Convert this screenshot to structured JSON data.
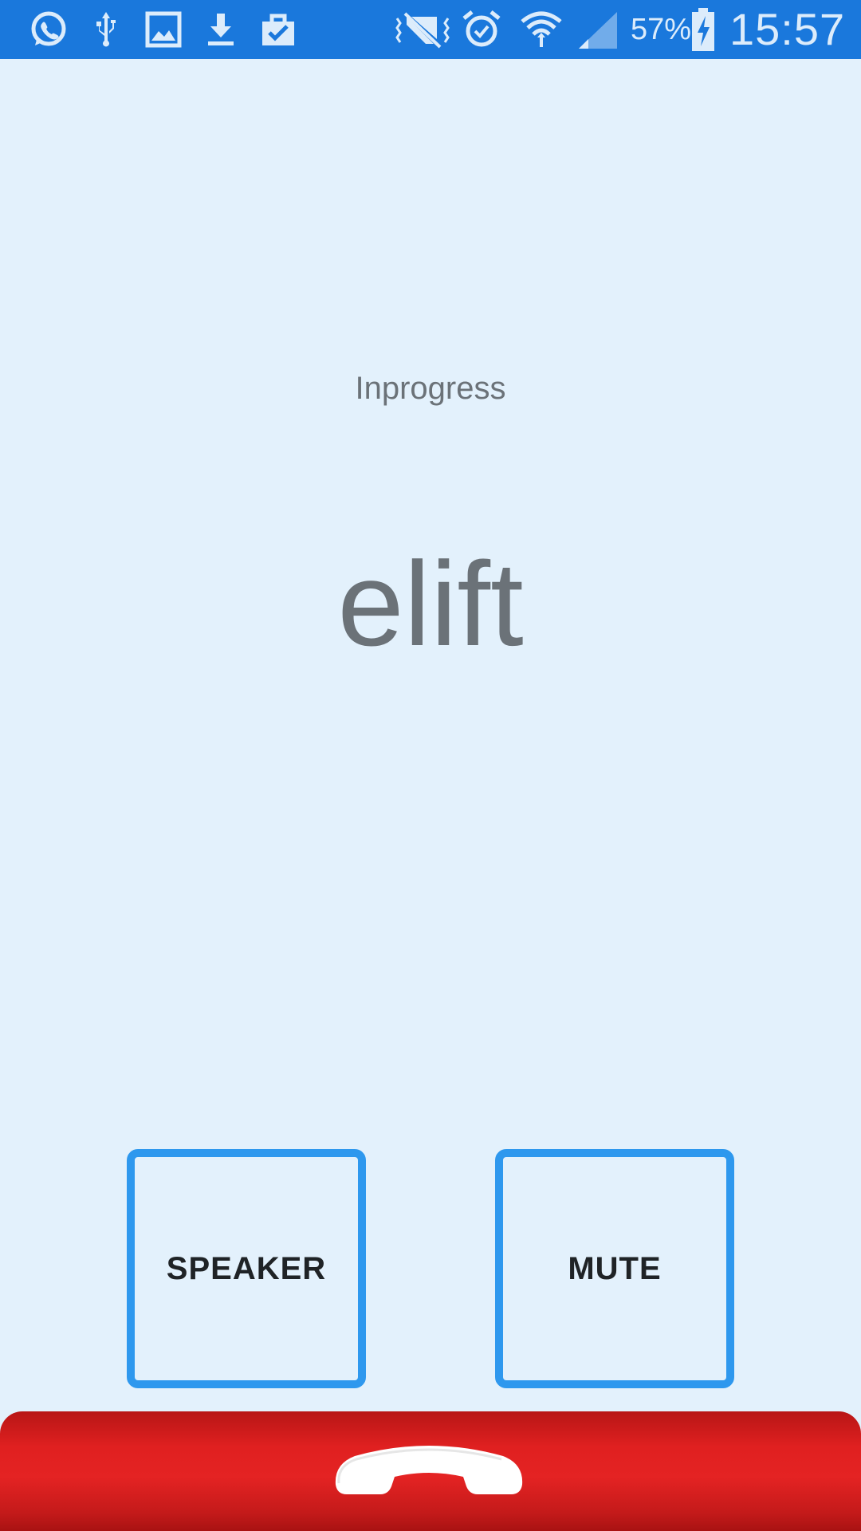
{
  "status_bar": {
    "notification_icons": [
      "whatsapp-icon",
      "usb-icon",
      "image-icon",
      "download-icon",
      "clipboard-check-icon"
    ],
    "system_icons": [
      "vibrate-icon",
      "alarm-icon",
      "wifi-icon",
      "signal-icon",
      "battery-charging-icon"
    ],
    "battery_percent": "57%",
    "time": "15:57"
  },
  "call": {
    "status": "Inprogress",
    "caller_name": "elift"
  },
  "controls": {
    "speaker_label": "SPEAKER",
    "mute_label": "MUTE"
  },
  "end_call": {
    "icon": "end-call-icon"
  },
  "colors": {
    "status_bar": "#1a78dc",
    "background": "#e3f1fc",
    "button_border": "#2e98ee",
    "end_call": "#e02020",
    "text_muted": "#6b7278"
  }
}
